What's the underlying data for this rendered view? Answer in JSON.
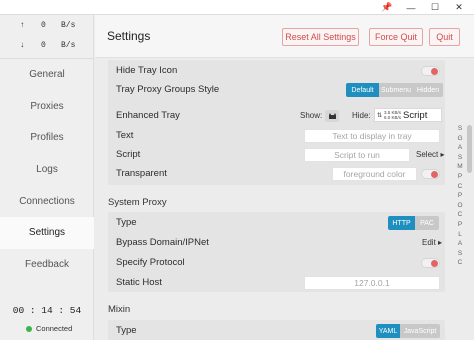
{
  "titlebar": {
    "pin": "📌",
    "minimize": "—",
    "maximize": "☐",
    "close": "✕"
  },
  "traffic": {
    "up": {
      "arrow": "↑",
      "value": "0",
      "unit": "B/s"
    },
    "down": {
      "arrow": "↓",
      "value": "0",
      "unit": "B/s"
    }
  },
  "nav": [
    {
      "label": "General"
    },
    {
      "label": "Proxies"
    },
    {
      "label": "Profiles"
    },
    {
      "label": "Logs"
    },
    {
      "label": "Connections"
    },
    {
      "label": "Settings",
      "active": true
    },
    {
      "label": "Feedback"
    }
  ],
  "status": {
    "time": "00 : 14 : 54",
    "connection": "Connected",
    "connection_color": "#3ab54a"
  },
  "header": {
    "title": "Settings",
    "reset_label": "Reset All Settings",
    "force_quit_label": "Force Quit",
    "quit_label": "Quit",
    "accent_color": "#d34b4b"
  },
  "general": {
    "hide_tray_icon": {
      "label": "Hide Tray Icon",
      "enabled": false
    },
    "tray_groups_style": {
      "label": "Tray Proxy Groups Style",
      "options": [
        "Default",
        "Submenu",
        "Hidden"
      ],
      "selected": "Default"
    },
    "enhanced_tray": {
      "label": "Enhanced Tray",
      "show_label": "Show:",
      "hide_label": "Hide:",
      "preview_speed_up": "3.5 KB/s",
      "preview_speed_down": "6.0 KB/s",
      "preview_word": "Script"
    },
    "text": {
      "label": "Text",
      "placeholder": "Text to display in tray"
    },
    "script": {
      "label": "Script",
      "placeholder": "Script to run",
      "select_label": "Select ▸"
    },
    "transparent": {
      "label": "Transparent",
      "placeholder": "foreground color",
      "enabled": false
    }
  },
  "system_proxy": {
    "title": "System Proxy",
    "type": {
      "label": "Type",
      "options": [
        "HTTP",
        "PAC"
      ],
      "selected": "HTTP"
    },
    "bypass": {
      "label": "Bypass Domain/IPNet",
      "edit_label": "Edit ▸"
    },
    "specify_protocol": {
      "label": "Specify Protocol",
      "enabled": false
    },
    "static_host": {
      "label": "Static Host",
      "placeholder": "127.0.0.1"
    }
  },
  "mixin": {
    "title": "Mixin",
    "type": {
      "label": "Type",
      "options": [
        "YAML",
        "JavaScript"
      ],
      "selected": "YAML"
    }
  },
  "alpha_index": [
    "S",
    "G",
    "A",
    "S",
    "M",
    "P",
    "C",
    "P",
    "O",
    "C",
    "P",
    "L",
    "A",
    "S",
    "C"
  ],
  "accent_color": "#1f8fc0"
}
